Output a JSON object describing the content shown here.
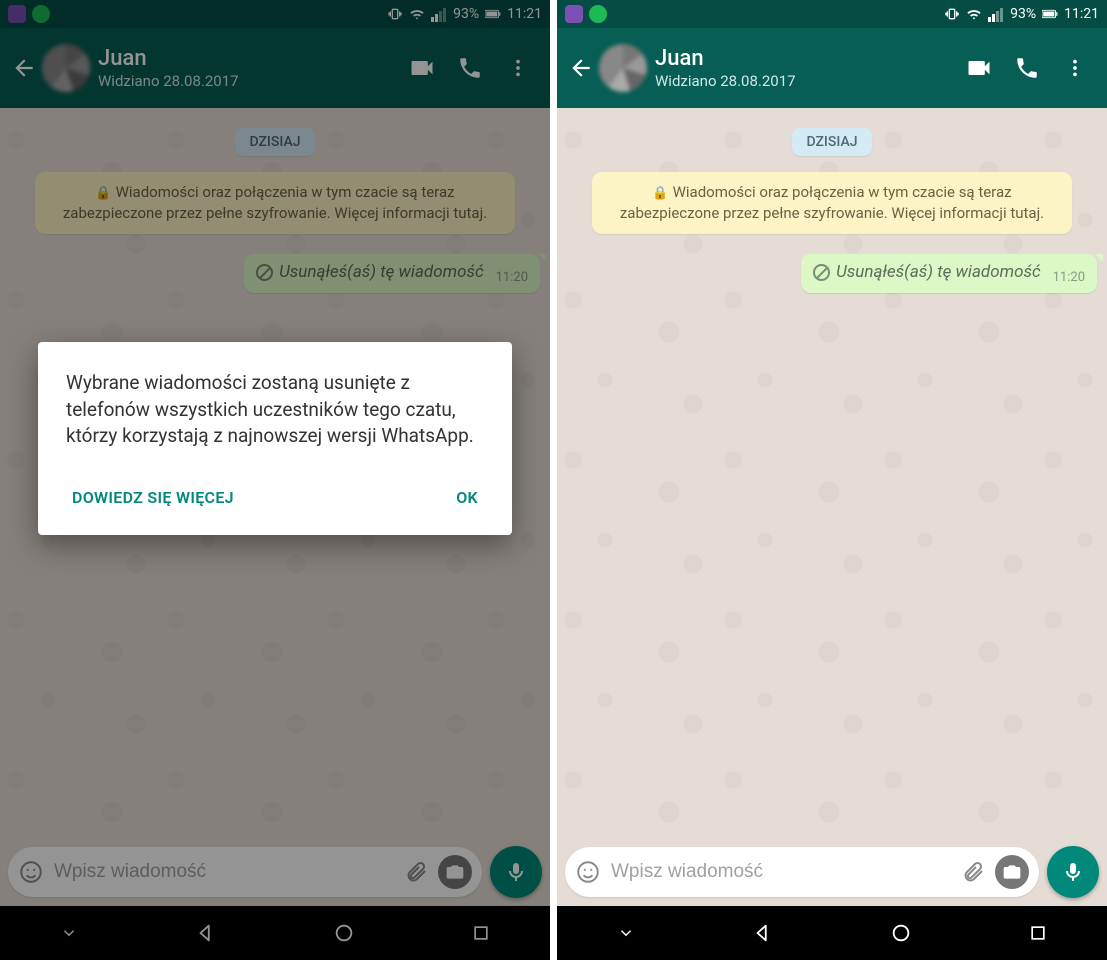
{
  "statusbar": {
    "battery_pct": "93%",
    "time": "11:21"
  },
  "header": {
    "contact_name": "Juan",
    "last_seen": "Widziano 28.08.2017"
  },
  "chat": {
    "date_label": "DZISIAJ",
    "encryption_notice": "Wiadomości oraz połączenia w tym czacie są teraz zabezpieczone przez pełne szyfrowanie. Więcej informacji tutaj.",
    "deleted_msg_text": "Usunąłeś(aś) tę wiadomość",
    "deleted_msg_time": "11:20"
  },
  "input": {
    "placeholder": "Wpisz wiadomość"
  },
  "dialog": {
    "body": "Wybrane wiadomości zostaną usunięte z telefonów wszystkich uczestników tego czatu, którzy korzystają z najnowszej wersji WhatsApp.",
    "learn_more": "DOWIEDZ SIĘ WIĘCEJ",
    "ok": "OK"
  }
}
